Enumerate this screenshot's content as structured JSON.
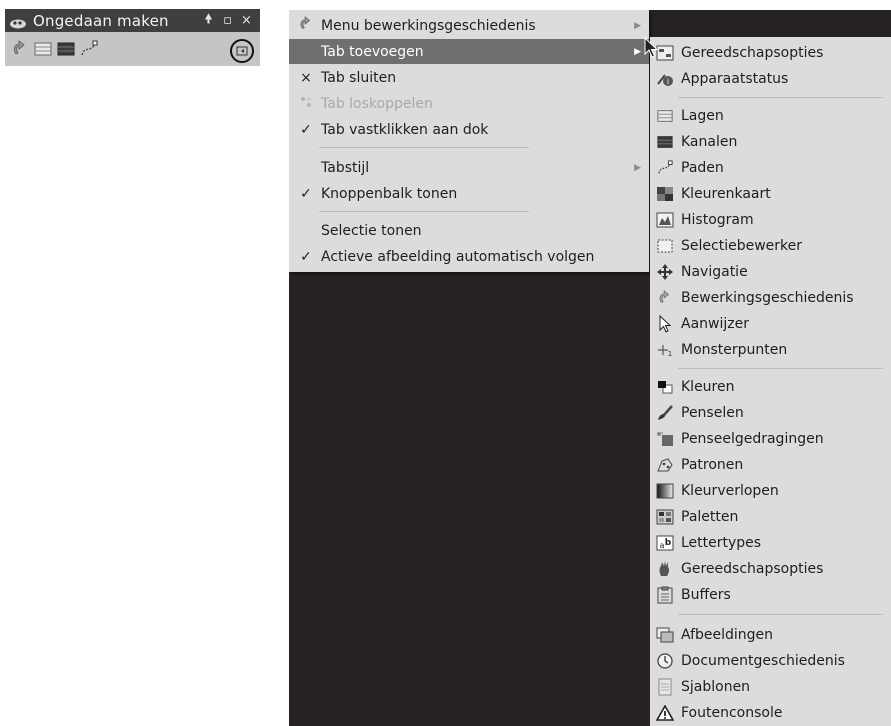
{
  "dock": {
    "title": "Ongedaan maken",
    "buttons": {
      "detach": "🠝",
      "maximize": "▫",
      "close": "×"
    },
    "toolbar_icons": [
      "undo-history-icon",
      "layers-icon",
      "channels-icon",
      "paths-icon"
    ],
    "tab_menu_icon": "tab-menu-icon"
  },
  "menu": {
    "items": [
      {
        "label": "Menu bewerkingsgeschiedenis",
        "mark": "",
        "icon": "undo-history-icon",
        "submenu": true
      },
      {
        "label": "Tab toevoegen",
        "mark": "",
        "submenu": true,
        "active": true
      },
      {
        "label": "Tab sluiten",
        "mark": "×"
      },
      {
        "label": "Tab loskoppelen",
        "mark": "",
        "disabled": true
      },
      {
        "label": "Tab vastklikken aan dok",
        "mark": "✓"
      },
      {
        "label": "Tabstijl",
        "mark": "",
        "submenu": true
      },
      {
        "label": "Knoppenbalk tonen",
        "mark": "✓"
      },
      {
        "label": "Selectie tonen",
        "mark": ""
      },
      {
        "label": "Actieve afbeelding automatisch volgen",
        "mark": "✓"
      }
    ]
  },
  "submenu": {
    "groups": [
      [
        {
          "label": "Gereedschapsopties",
          "icon": "tool-options-icon"
        },
        {
          "label": "Apparaatstatus",
          "icon": "device-status-icon"
        }
      ],
      [
        {
          "label": "Lagen",
          "icon": "layers-icon"
        },
        {
          "label": "Kanalen",
          "icon": "channels-icon"
        },
        {
          "label": "Paden",
          "icon": "paths-icon"
        },
        {
          "label": "Kleurenkaart",
          "icon": "colormap-icon"
        },
        {
          "label": "Histogram",
          "icon": "histogram-icon"
        },
        {
          "label": "Selectiebewerker",
          "icon": "selection-editor-icon"
        },
        {
          "label": "Navigatie",
          "icon": "navigation-icon"
        },
        {
          "label": "Bewerkingsgeschiedenis",
          "icon": "undo-history-icon"
        },
        {
          "label": "Aanwijzer",
          "icon": "pointer-icon"
        },
        {
          "label": "Monsterpunten",
          "icon": "sample-points-icon"
        }
      ],
      [
        {
          "label": "Kleuren",
          "icon": "colors-icon"
        },
        {
          "label": "Penselen",
          "icon": "brushes-icon"
        },
        {
          "label": "Penseelgedragingen",
          "icon": "paint-dynamics-icon"
        },
        {
          "label": "Patronen",
          "icon": "patterns-icon"
        },
        {
          "label": "Kleurverlopen",
          "icon": "gradients-icon"
        },
        {
          "label": "Paletten",
          "icon": "palettes-icon"
        },
        {
          "label": "Lettertypes",
          "icon": "fonts-icon"
        },
        {
          "label": "Gereedschapsopties",
          "icon": "tool-presets-icon"
        },
        {
          "label": "Buffers",
          "icon": "buffers-icon"
        }
      ],
      [
        {
          "label": "Afbeeldingen",
          "icon": "images-icon"
        },
        {
          "label": "Documentgeschiedenis",
          "icon": "document-history-icon"
        },
        {
          "label": "Sjablonen",
          "icon": "templates-icon"
        },
        {
          "label": "Foutenconsole",
          "icon": "error-console-icon"
        }
      ]
    ]
  },
  "colors": {
    "menu_bg": "#dcdcdc",
    "highlight": "#6f6f6f",
    "canvas": "#262223",
    "titlebar": "#3f3f3f"
  }
}
